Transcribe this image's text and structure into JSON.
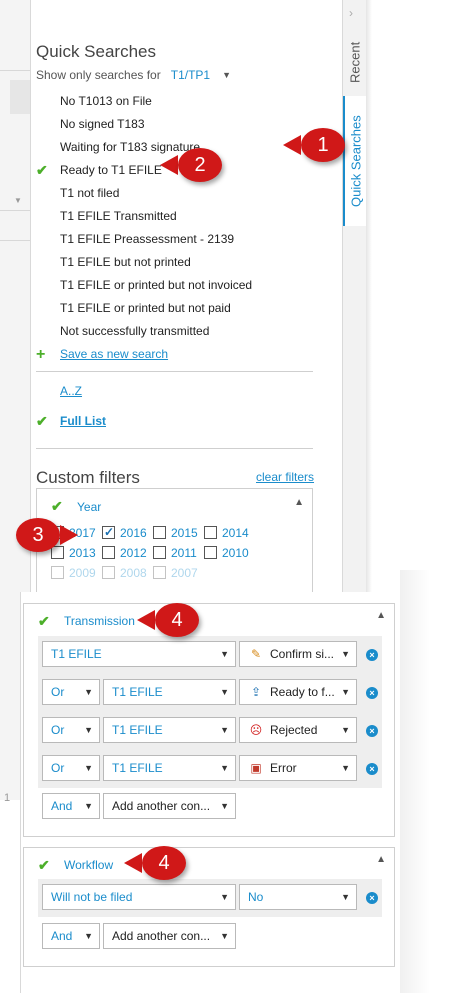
{
  "quick_searches": {
    "title": "Quick Searches",
    "show_label": "Show only searches for",
    "show_value": "T1/TP1",
    "items": [
      {
        "label": "No T1013 on File",
        "checked": false
      },
      {
        "label": "No signed T183",
        "checked": false
      },
      {
        "label": "Waiting for T183 signature",
        "checked": false
      },
      {
        "label": "Ready to T1 EFILE",
        "checked": true
      },
      {
        "label": "T1 not filed",
        "checked": false
      },
      {
        "label": "T1 EFILE Transmitted",
        "checked": false
      },
      {
        "label": "T1 EFILE Preassessment - 2139",
        "checked": false
      },
      {
        "label": "T1 EFILE but not printed",
        "checked": false
      },
      {
        "label": "T1 EFILE or printed but not invoiced",
        "checked": false
      },
      {
        "label": "T1 EFILE or printed but not paid",
        "checked": false
      },
      {
        "label": "Not successfully transmitted",
        "checked": false
      }
    ],
    "save_new": "Save as new search",
    "az": "A..Z",
    "full_list": "Full List"
  },
  "side_tabs": {
    "recent": "Recent",
    "quick_searches": "Quick Searches"
  },
  "custom_filters": {
    "title": "Custom filters",
    "clear": "clear filters",
    "year": {
      "label": "Year",
      "years": [
        {
          "label": "2017",
          "checked": false
        },
        {
          "label": "2016",
          "checked": true
        },
        {
          "label": "2015",
          "checked": false
        },
        {
          "label": "2014",
          "checked": false
        },
        {
          "label": "2013",
          "checked": false
        },
        {
          "label": "2012",
          "checked": false
        },
        {
          "label": "2011",
          "checked": false
        },
        {
          "label": "2010",
          "checked": false
        },
        {
          "label": "2009",
          "checked": false
        },
        {
          "label": "2008",
          "checked": false
        },
        {
          "label": "2007",
          "checked": false
        }
      ]
    },
    "transmission": {
      "label": "Transmission",
      "rows": [
        {
          "op": "",
          "field": "T1 EFILE",
          "status": "Confirm si..."
        },
        {
          "op": "Or",
          "field": "T1 EFILE",
          "status": "Ready to f..."
        },
        {
          "op": "Or",
          "field": "T1 EFILE",
          "status": "Rejected"
        },
        {
          "op": "Or",
          "field": "T1 EFILE",
          "status": "Error"
        }
      ],
      "add_op": "And",
      "add_condition": "Add another con..."
    },
    "workflow": {
      "label": "Workflow",
      "rows": [
        {
          "field": "Will not be filed",
          "value": "No"
        }
      ],
      "add_op": "And",
      "add_condition": "Add another con..."
    }
  },
  "callouts": [
    "1",
    "2",
    "3",
    "4",
    "4"
  ],
  "background": {
    "page_number": "1"
  },
  "colors": {
    "accent": "#1a8ccb",
    "check": "#4caf2a",
    "callout": "#d01818"
  }
}
